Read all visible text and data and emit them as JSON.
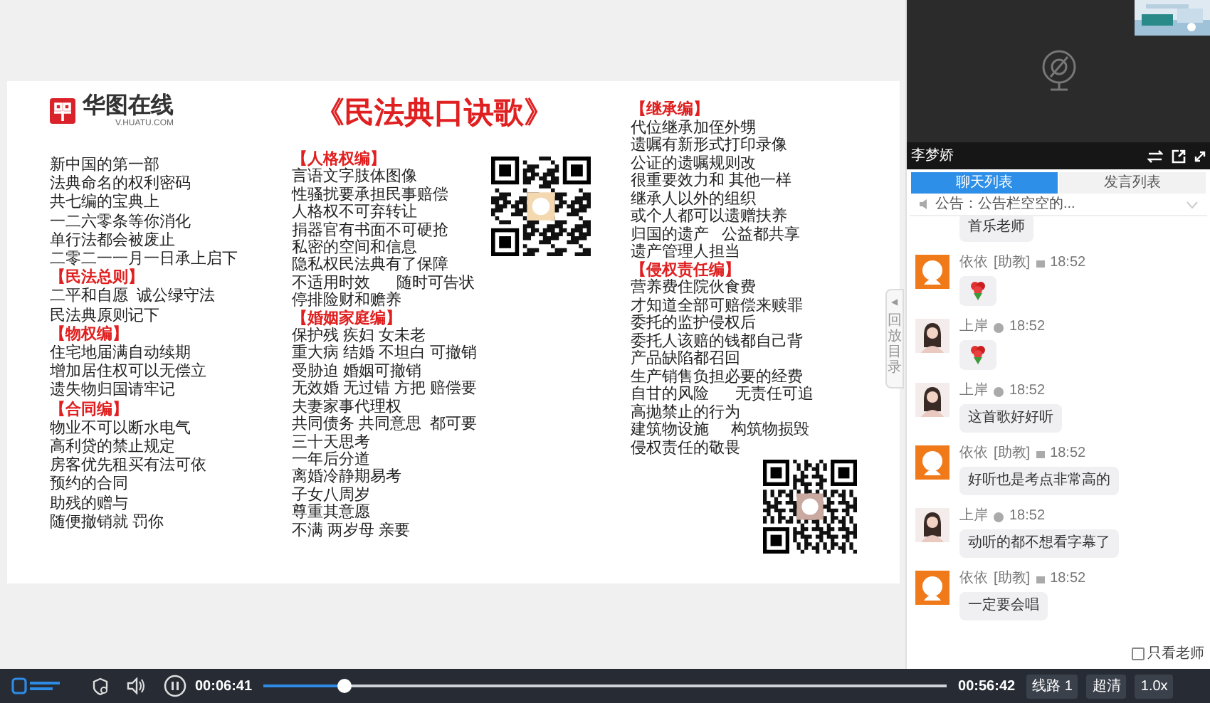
{
  "slide": {
    "logo": {
      "name": "华图在线",
      "url": "V.HUATU.COM"
    },
    "title": "《民法典口诀歌》",
    "columns": [
      [
        {
          "kind": "line",
          "text": "新中国的第一部"
        },
        {
          "kind": "line",
          "text": "法典命名的权利密码"
        },
        {
          "kind": "line",
          "text": "共七编的宝典上"
        },
        {
          "kind": "line",
          "text": "一二六零条等你消化"
        },
        {
          "kind": "line",
          "text": "单行法都会被废止"
        },
        {
          "kind": "line",
          "text": "二零二一一月一日承上启下"
        },
        {
          "kind": "heading",
          "text": "【民法总则】"
        },
        {
          "kind": "line",
          "text": "二平和自愿  诚公绿守法"
        },
        {
          "kind": "line",
          "text": "民法典原则记下"
        },
        {
          "kind": "heading",
          "text": "【物权编】"
        },
        {
          "kind": "line",
          "text": "住宅地届满自动续期"
        },
        {
          "kind": "line",
          "text": "增加居住权可以无偿立"
        },
        {
          "kind": "line",
          "text": "遗失物归国请牢记"
        },
        {
          "kind": "heading",
          "text": "【合同编】"
        },
        {
          "kind": "line",
          "text": "物业不可以断水电气"
        },
        {
          "kind": "line",
          "text": "高利贷的禁止规定"
        },
        {
          "kind": "line",
          "text": "房客优先租买有法可依"
        },
        {
          "kind": "line",
          "text": "预约的合同"
        },
        {
          "kind": "line",
          "text": "助残的赠与"
        },
        {
          "kind": "line",
          "text": "随便撤销就 罚你"
        }
      ],
      [
        {
          "kind": "heading",
          "text": "【人格权编】"
        },
        {
          "kind": "line",
          "text": "言语文字肢体图像"
        },
        {
          "kind": "line",
          "text": "性骚扰要承担民事赔偿"
        },
        {
          "kind": "line",
          "text": "人格权不可弃转让"
        },
        {
          "kind": "line",
          "text": "捐器官有书面不可硬抢"
        },
        {
          "kind": "line",
          "text": "私密的空间和信息"
        },
        {
          "kind": "line",
          "text": "隐私权民法典有了保障"
        },
        {
          "kind": "line",
          "text": "不适用时效      随时可告状"
        },
        {
          "kind": "line",
          "text": "停排险财和赡养"
        },
        {
          "kind": "heading",
          "text": "【婚姻家庭编】"
        },
        {
          "kind": "line",
          "text": "保护残 疾妇 女未老"
        },
        {
          "kind": "line",
          "text": "重大病 结婚 不坦白 可撤销"
        },
        {
          "kind": "line",
          "text": "受胁迫 婚姻可撤销"
        },
        {
          "kind": "line",
          "text": "无效婚 无过错 方把 赔偿要"
        },
        {
          "kind": "line",
          "text": "夫妻家事代理权"
        },
        {
          "kind": "line",
          "text": "共同债务 共同意思  都可要"
        },
        {
          "kind": "line",
          "text": "三十天思考"
        },
        {
          "kind": "line",
          "text": "一年后分道"
        },
        {
          "kind": "line",
          "text": "离婚冷静期易考"
        },
        {
          "kind": "line",
          "text": "子女八周岁"
        },
        {
          "kind": "line",
          "text": "尊重其意愿"
        },
        {
          "kind": "line",
          "text": "不满 两岁母 亲要"
        }
      ],
      [
        {
          "kind": "heading",
          "text": "【继承编】"
        },
        {
          "kind": "line",
          "text": "代位继承加侄外甥"
        },
        {
          "kind": "line",
          "text": "遗嘱有新形式打印录像"
        },
        {
          "kind": "line",
          "text": "公证的遗嘱规则改"
        },
        {
          "kind": "line",
          "text": "很重要效力和 其他一样"
        },
        {
          "kind": "line",
          "text": "继承人以外的组织"
        },
        {
          "kind": "line",
          "text": "或个人都可以遗赠扶养"
        },
        {
          "kind": "line",
          "text": "归国的遗产   公益都共享"
        },
        {
          "kind": "line",
          "text": "遗产管理人担当"
        },
        {
          "kind": "heading",
          "text": "【侵权责任编】"
        },
        {
          "kind": "line",
          "text": "营养费住院伙食费"
        },
        {
          "kind": "line",
          "text": "才知道全部可赔偿来赎罪"
        },
        {
          "kind": "line",
          "text": "委托的监护侵权后"
        },
        {
          "kind": "line",
          "text": "委托人该赔的钱都自己背"
        },
        {
          "kind": "line",
          "text": "产品缺陷都召回"
        },
        {
          "kind": "line",
          "text": "生产销售负担必要的经费"
        },
        {
          "kind": "line",
          "text": "自甘的风险      无责任可追"
        },
        {
          "kind": "line",
          "text": "高抛禁止的行为"
        },
        {
          "kind": "line",
          "text": "建筑物设施     构筑物损毁"
        },
        {
          "kind": "line",
          "text": "侵权责任的敬畏"
        }
      ]
    ]
  },
  "side_tab": {
    "arrow": "◀",
    "label": "回放目录"
  },
  "teacher_video": {
    "name": "李梦娇"
  },
  "chat": {
    "tabs": [
      {
        "label": "聊天列表",
        "selected": true
      },
      {
        "label": "发言列表",
        "selected": false
      }
    ],
    "announcement": "公告：公告栏空空的...",
    "messages": [
      {
        "kind": "text",
        "text": "首乐老师"
      },
      {
        "kind": "flower",
        "author": "依依",
        "role": "[助教]",
        "time": "18:52"
      },
      {
        "kind": "flower",
        "author": "上岸",
        "time": "18:52"
      },
      {
        "kind": "text",
        "author": "上岸",
        "time": "18:52",
        "text": "这首歌好好听"
      },
      {
        "kind": "text",
        "author": "依依",
        "role": "[助教]",
        "time": "18:52",
        "text": "好听也是考点非常高的"
      },
      {
        "kind": "text",
        "author": "上岸",
        "time": "18:52",
        "text": "动听的都不想看字幕了"
      },
      {
        "kind": "text",
        "author": "依依",
        "role": "[助教]",
        "time": "18:52",
        "text": "一定要会唱"
      }
    ],
    "only_teacher": {
      "label": "只看老师",
      "checked": false
    }
  },
  "player": {
    "current_time": "00:06:41",
    "progress": {
      "level": 0.118
    },
    "duration": "00:56:42",
    "buttons": [
      "线路 1",
      "超清",
      "1.0x"
    ]
  }
}
